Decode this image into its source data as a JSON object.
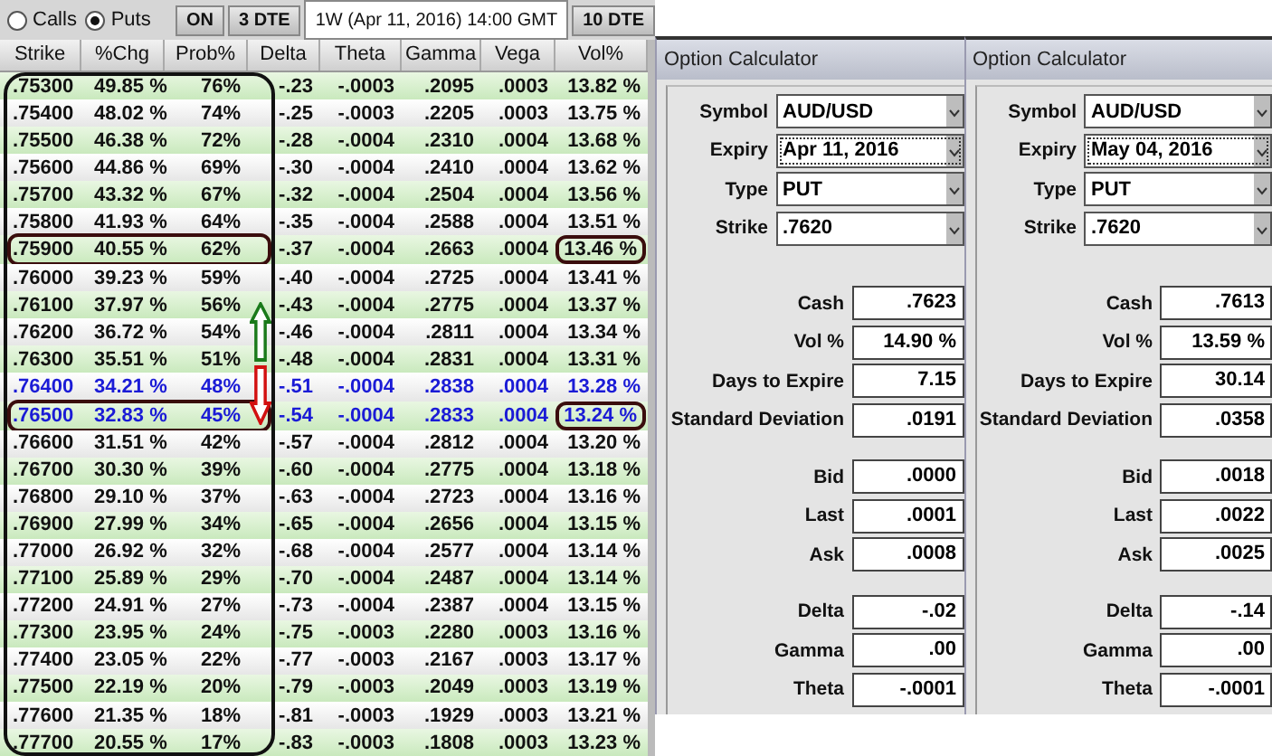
{
  "mode": [
    {
      "label": "Calls",
      "selected": false
    },
    {
      "label": "Puts",
      "selected": true
    }
  ],
  "tabs": [
    {
      "label": "ON",
      "selected": false
    },
    {
      "label": "3 DTE",
      "selected": false
    },
    {
      "label": "1W (Apr 11, 2016) 14:00 GMT",
      "selected": true
    },
    {
      "label": "10 DTE",
      "selected": false
    }
  ],
  "table": {
    "columns": [
      "Strike",
      "%Chg",
      "Prob%",
      "Delta",
      "Theta",
      "Gamma",
      "Vega",
      "Vol%"
    ],
    "rows": [
      {
        "cells": [
          ".75300",
          "49.85 %",
          "76%",
          "-.23",
          "-.0003",
          ".2095",
          ".0003",
          "13.82 %"
        ],
        "highlighted": false,
        "circled": false
      },
      {
        "cells": [
          ".75400",
          "48.02 %",
          "74%",
          "-.25",
          "-.0003",
          ".2205",
          ".0003",
          "13.75 %"
        ],
        "highlighted": false,
        "circled": false
      },
      {
        "cells": [
          ".75500",
          "46.38 %",
          "72%",
          "-.28",
          "-.0004",
          ".2310",
          ".0004",
          "13.68 %"
        ],
        "highlighted": false,
        "circled": false
      },
      {
        "cells": [
          ".75600",
          "44.86 %",
          "69%",
          "-.30",
          "-.0004",
          ".2410",
          ".0004",
          "13.62 %"
        ],
        "highlighted": false,
        "circled": false
      },
      {
        "cells": [
          ".75700",
          "43.32 %",
          "67%",
          "-.32",
          "-.0004",
          ".2504",
          ".0004",
          "13.56 %"
        ],
        "highlighted": false,
        "circled": false
      },
      {
        "cells": [
          ".75800",
          "41.93 %",
          "64%",
          "-.35",
          "-.0004",
          ".2588",
          ".0004",
          "13.51 %"
        ],
        "highlighted": false,
        "circled": false
      },
      {
        "cells": [
          ".75900",
          "40.55 %",
          "62%",
          "-.37",
          "-.0004",
          ".2663",
          ".0004",
          "13.46 %"
        ],
        "highlighted": false,
        "circled": true
      },
      {
        "cells": [
          ".76000",
          "39.23 %",
          "59%",
          "-.40",
          "-.0004",
          ".2725",
          ".0004",
          "13.41 %"
        ],
        "highlighted": false,
        "circled": false
      },
      {
        "cells": [
          ".76100",
          "37.97 %",
          "56%",
          "-.43",
          "-.0004",
          ".2775",
          ".0004",
          "13.37 %"
        ],
        "highlighted": false,
        "circled": false
      },
      {
        "cells": [
          ".76200",
          "36.72 %",
          "54%",
          "-.46",
          "-.0004",
          ".2811",
          ".0004",
          "13.34 %"
        ],
        "highlighted": false,
        "circled": false
      },
      {
        "cells": [
          ".76300",
          "35.51 %",
          "51%",
          "-.48",
          "-.0004",
          ".2831",
          ".0004",
          "13.31 %"
        ],
        "highlighted": false,
        "circled": false
      },
      {
        "cells": [
          ".76400",
          "34.21 %",
          "48%",
          "-.51",
          "-.0004",
          ".2838",
          ".0004",
          "13.28 %"
        ],
        "highlighted": true,
        "circled": false
      },
      {
        "cells": [
          ".76500",
          "32.83 %",
          "45%",
          "-.54",
          "-.0004",
          ".2833",
          ".0004",
          "13.24 %"
        ],
        "highlighted": true,
        "circled": true
      },
      {
        "cells": [
          ".76600",
          "31.51 %",
          "42%",
          "-.57",
          "-.0004",
          ".2812",
          ".0004",
          "13.20 %"
        ],
        "highlighted": false,
        "circled": false
      },
      {
        "cells": [
          ".76700",
          "30.30 %",
          "39%",
          "-.60",
          "-.0004",
          ".2775",
          ".0004",
          "13.18 %"
        ],
        "highlighted": false,
        "circled": false
      },
      {
        "cells": [
          ".76800",
          "29.10 %",
          "37%",
          "-.63",
          "-.0004",
          ".2723",
          ".0004",
          "13.16 %"
        ],
        "highlighted": false,
        "circled": false
      },
      {
        "cells": [
          ".76900",
          "27.99 %",
          "34%",
          "-.65",
          "-.0004",
          ".2656",
          ".0004",
          "13.15 %"
        ],
        "highlighted": false,
        "circled": false
      },
      {
        "cells": [
          ".77000",
          "26.92 %",
          "32%",
          "-.68",
          "-.0004",
          ".2577",
          ".0004",
          "13.14 %"
        ],
        "highlighted": false,
        "circled": false
      },
      {
        "cells": [
          ".77100",
          "25.89 %",
          "29%",
          "-.70",
          "-.0004",
          ".2487",
          ".0004",
          "13.14 %"
        ],
        "highlighted": false,
        "circled": false
      },
      {
        "cells": [
          ".77200",
          "24.91 %",
          "27%",
          "-.73",
          "-.0004",
          ".2387",
          ".0004",
          "13.15 %"
        ],
        "highlighted": false,
        "circled": false
      },
      {
        "cells": [
          ".77300",
          "23.95 %",
          "24%",
          "-.75",
          "-.0003",
          ".2280",
          ".0003",
          "13.16 %"
        ],
        "highlighted": false,
        "circled": false
      },
      {
        "cells": [
          ".77400",
          "23.05 %",
          "22%",
          "-.77",
          "-.0003",
          ".2167",
          ".0003",
          "13.17 %"
        ],
        "highlighted": false,
        "circled": false
      },
      {
        "cells": [
          ".77500",
          "22.19 %",
          "20%",
          "-.79",
          "-.0003",
          ".2049",
          ".0003",
          "13.19 %"
        ],
        "highlighted": false,
        "circled": false
      },
      {
        "cells": [
          ".77600",
          "21.35 %",
          "18%",
          "-.81",
          "-.0003",
          ".1929",
          ".0003",
          "13.21 %"
        ],
        "highlighted": false,
        "circled": false
      },
      {
        "cells": [
          ".77700",
          "20.55 %",
          "17%",
          "-.83",
          "-.0003",
          ".1808",
          ".0003",
          "13.23 %"
        ],
        "highlighted": false,
        "circled": false
      }
    ]
  },
  "calculators": [
    {
      "title": "Option Calculator",
      "selects": [
        {
          "label": "Symbol",
          "value": "AUD/USD",
          "focused": false
        },
        {
          "label": "Expiry",
          "value": "Apr 11, 2016",
          "focused": true
        },
        {
          "label": "Type",
          "value": "PUT",
          "focused": false
        },
        {
          "label": "Strike",
          "value": ".7620",
          "focused": false
        }
      ],
      "groups": [
        [
          {
            "label": "Cash",
            "value": ".7623"
          },
          {
            "label": "Vol %",
            "value": "14.90 %"
          },
          {
            "label": "Days to Expire",
            "value": "7.15"
          },
          {
            "label": "Standard Deviation",
            "value": ".0191"
          }
        ],
        [
          {
            "label": "Bid",
            "value": ".0000"
          },
          {
            "label": "Last",
            "value": ".0001"
          },
          {
            "label": "Ask",
            "value": ".0008"
          }
        ],
        [
          {
            "label": "Delta",
            "value": "-.02"
          },
          {
            "label": "Gamma",
            "value": ".00"
          },
          {
            "label": "Theta",
            "value": "-.0001"
          }
        ]
      ]
    },
    {
      "title": "Option Calculator",
      "selects": [
        {
          "label": "Symbol",
          "value": "AUD/USD",
          "focused": false
        },
        {
          "label": "Expiry",
          "value": "May 04, 2016",
          "focused": true
        },
        {
          "label": "Type",
          "value": "PUT",
          "focused": false
        },
        {
          "label": "Strike",
          "value": ".7620",
          "focused": false
        }
      ],
      "groups": [
        [
          {
            "label": "Cash",
            "value": ".7613"
          },
          {
            "label": "Vol %",
            "value": "13.59 %"
          },
          {
            "label": "Days to Expire",
            "value": "30.14"
          },
          {
            "label": "Standard Deviation",
            "value": ".0358"
          }
        ],
        [
          {
            "label": "Bid",
            "value": ".0018"
          },
          {
            "label": "Last",
            "value": ".0022"
          },
          {
            "label": "Ask",
            "value": ".0025"
          }
        ],
        [
          {
            "label": "Delta",
            "value": "-.14"
          },
          {
            "label": "Gamma",
            "value": ".00"
          },
          {
            "label": "Theta",
            "value": "-.0001"
          }
        ]
      ]
    }
  ]
}
